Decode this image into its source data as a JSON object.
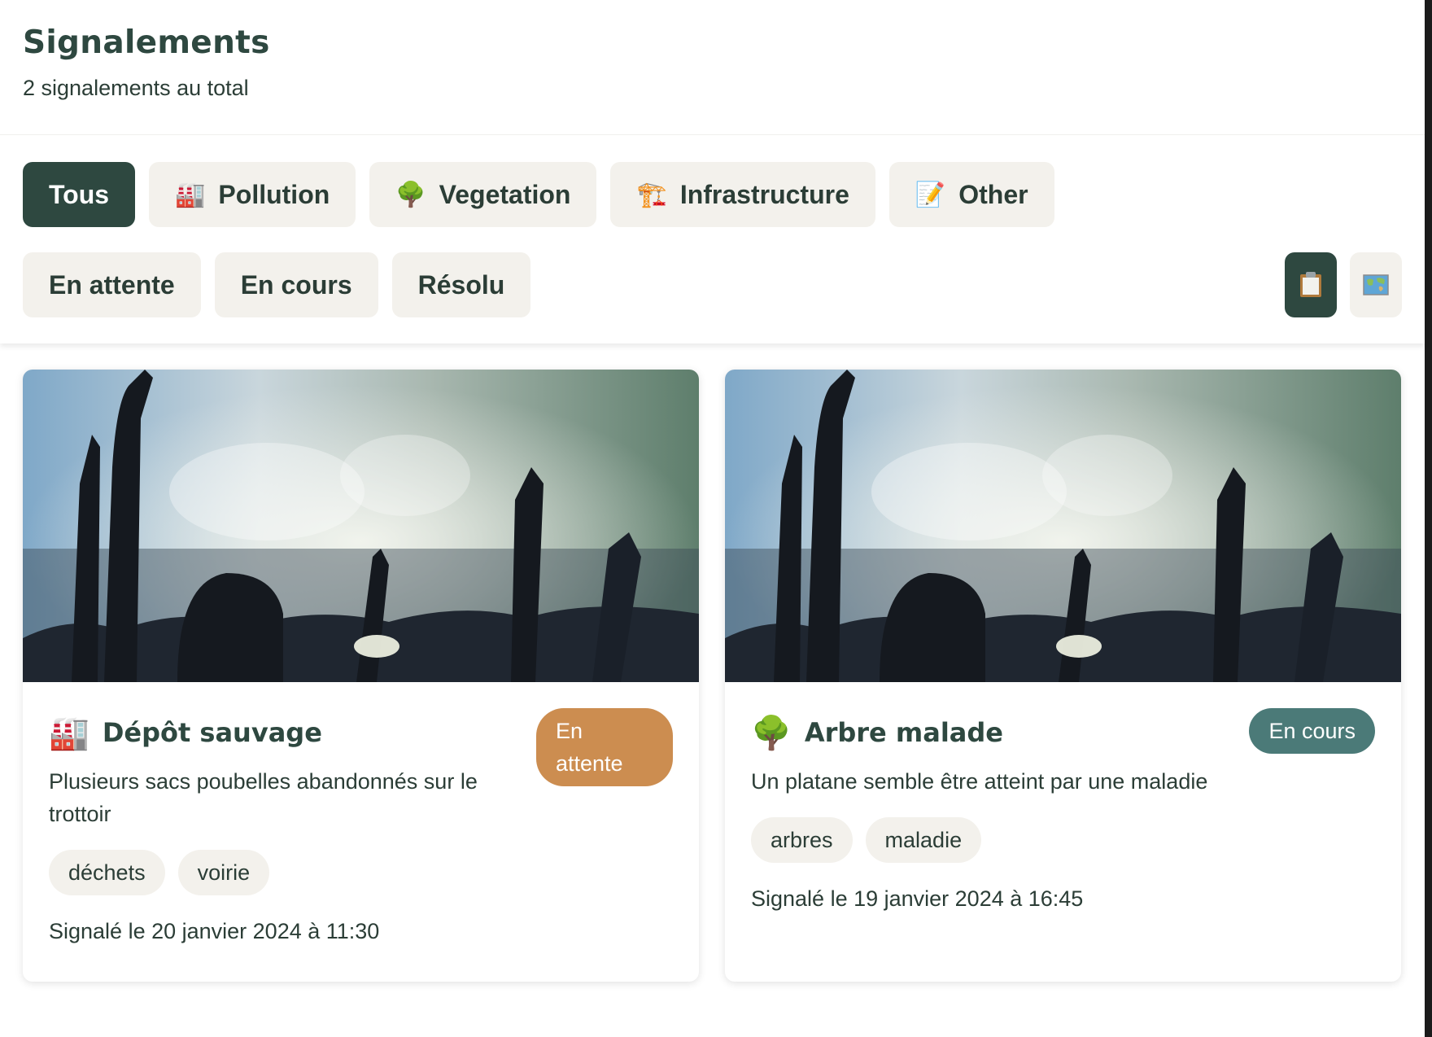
{
  "header": {
    "title": "Signalements",
    "subtitle": "2 signalements au total"
  },
  "category_filters": [
    {
      "label": "Tous",
      "icon": "",
      "active": true
    },
    {
      "label": "Pollution",
      "icon": "🏭",
      "icon_name": "factory-icon",
      "active": false
    },
    {
      "label": "Vegetation",
      "icon": "🌳",
      "icon_name": "tree-icon",
      "active": false
    },
    {
      "label": "Infrastructure",
      "icon": "🏗️",
      "icon_name": "construction-crane-icon",
      "active": false
    },
    {
      "label": "Other",
      "icon": "📝",
      "icon_name": "memo-icon",
      "active": false
    }
  ],
  "status_filters": [
    {
      "label": "En attente"
    },
    {
      "label": "En cours"
    },
    {
      "label": "Résolu"
    }
  ],
  "view_toggle": {
    "list": {
      "icon_name": "clipboard-icon",
      "active": true
    },
    "map": {
      "icon_name": "world-map-icon",
      "active": false
    }
  },
  "reports": [
    {
      "emoji": "🏭",
      "icon_name": "factory-icon",
      "title": "Dépôt sauvage",
      "status": "En attente",
      "status_color": "#cc8d50",
      "description": "Plusieurs sacs poubelles abandonnés sur le trottoir",
      "tags": [
        "déchets",
        "voirie"
      ],
      "date": "Signalé le 20 janvier 2024 à 11:30"
    },
    {
      "emoji": "🌳",
      "icon_name": "tree-icon",
      "title": "Arbre malade",
      "status": "En cours",
      "status_color": "#4b7a78",
      "description": "Un platane semble être atteint par une maladie",
      "tags": [
        "arbres",
        "maladie"
      ],
      "date": "Signalé le 19 janvier 2024 à 16:45"
    }
  ],
  "colors": {
    "primary": "#2e4840",
    "chip_bg": "#f3f1ec",
    "pending": "#cc8d50",
    "in_progress": "#4b7a78"
  }
}
